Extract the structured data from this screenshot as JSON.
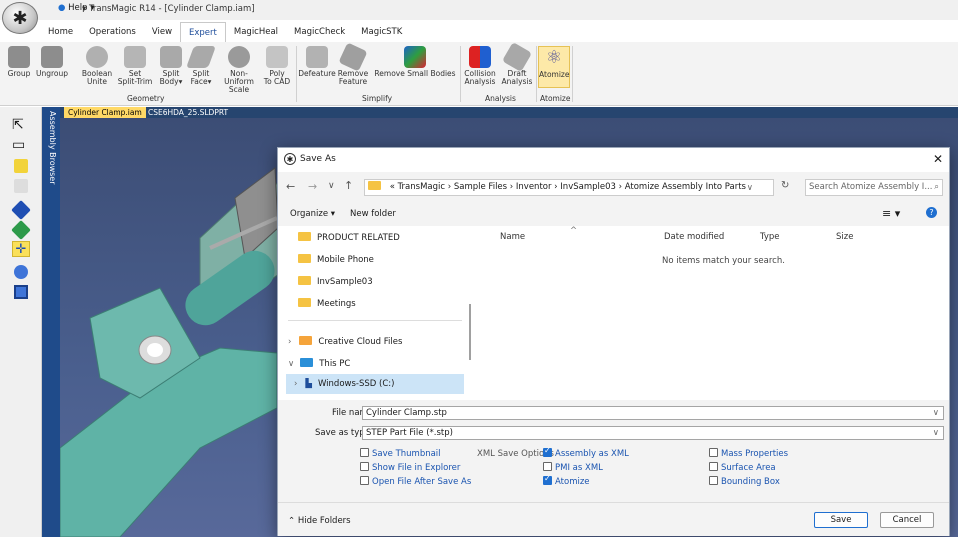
{
  "app": {
    "title": "TransMagic R14 - [Cylinder Clamp.iam]",
    "help_label": "Help"
  },
  "menu_tabs": [
    "Home",
    "Operations",
    "View",
    "Expert",
    "MagicHeal",
    "MagicCheck",
    "MagicSTK"
  ],
  "active_tab": "Expert",
  "ribbon": {
    "groups": [
      {
        "label": "Geometry"
      },
      {
        "label": "Simplify"
      },
      {
        "label": "Analysis"
      },
      {
        "label": "Atomize"
      }
    ],
    "buttons": [
      {
        "l1": "Group",
        "l2": ""
      },
      {
        "l1": "Ungroup",
        "l2": ""
      },
      {
        "l1": "Boolean",
        "l2": "Unite"
      },
      {
        "l1": "Set",
        "l2": "Split-Trim"
      },
      {
        "l1": "Split",
        "l2": "Body"
      },
      {
        "l1": "Split",
        "l2": "Face"
      },
      {
        "l1": "Non-Uniform",
        "l2": "Scale"
      },
      {
        "l1": "Poly",
        "l2": "To CAD"
      },
      {
        "l1": "Defeature",
        "l2": ""
      },
      {
        "l1": "Remove",
        "l2": "Feature"
      },
      {
        "l1": "Remove Small Bodies",
        "l2": ""
      },
      {
        "l1": "Collision",
        "l2": "Analysis"
      },
      {
        "l1": "Draft",
        "l2": "Analysis"
      },
      {
        "l1": "Atomize",
        "l2": ""
      }
    ]
  },
  "browser_label": "Assembly Browser",
  "doc_tabs": [
    "Cylinder Clamp.iam",
    "CSE6HDA_25.SLDPRT"
  ],
  "dialog": {
    "title": "Save As",
    "breadcrumb": [
      "«",
      "TransMagic",
      "Sample Files",
      "Inventor",
      "InvSample03",
      "Atomize Assembly Into Parts"
    ],
    "search_placeholder": "Search Atomize Assembly I...",
    "organize_label": "Organize ▾",
    "new_folder_label": "New folder",
    "nav_items": [
      {
        "label": "PRODUCT RELATED",
        "kind": "folder"
      },
      {
        "label": "Mobile Phone",
        "kind": "folder"
      },
      {
        "label": "InvSample03",
        "kind": "folder"
      },
      {
        "label": "Meetings",
        "kind": "folder"
      },
      {
        "label": "Creative Cloud Files",
        "kind": "cloud"
      },
      {
        "label": "This PC",
        "kind": "pc"
      },
      {
        "label": "Windows-SSD (C:)",
        "kind": "drive"
      }
    ],
    "columns": [
      "Name",
      "Date modified",
      "Type",
      "Size"
    ],
    "empty_message": "No items match your search.",
    "file_name_label": "File name:",
    "file_name_value": "Cylinder Clamp.stp",
    "save_type_label": "Save as type:",
    "save_type_value": "STEP Part File (*.stp)",
    "xml_options_label": "XML Save Options",
    "options_col1": [
      {
        "label": "Save Thumbnail",
        "checked": false
      },
      {
        "label": "Show File in Explorer",
        "checked": false
      },
      {
        "label": "Open File After Save As",
        "checked": false
      }
    ],
    "options_col2": [
      {
        "label": "Assembly as XML",
        "checked": true
      },
      {
        "label": "PMI as XML",
        "checked": false
      },
      {
        "label": "Atomize",
        "checked": true
      }
    ],
    "options_col3": [
      {
        "label": "Mass Properties",
        "checked": false
      },
      {
        "label": "Surface Area",
        "checked": false
      },
      {
        "label": "Bounding Box",
        "checked": false
      }
    ],
    "hide_folders_label": "Hide Folders",
    "save_label": "Save",
    "cancel_label": "Cancel"
  }
}
